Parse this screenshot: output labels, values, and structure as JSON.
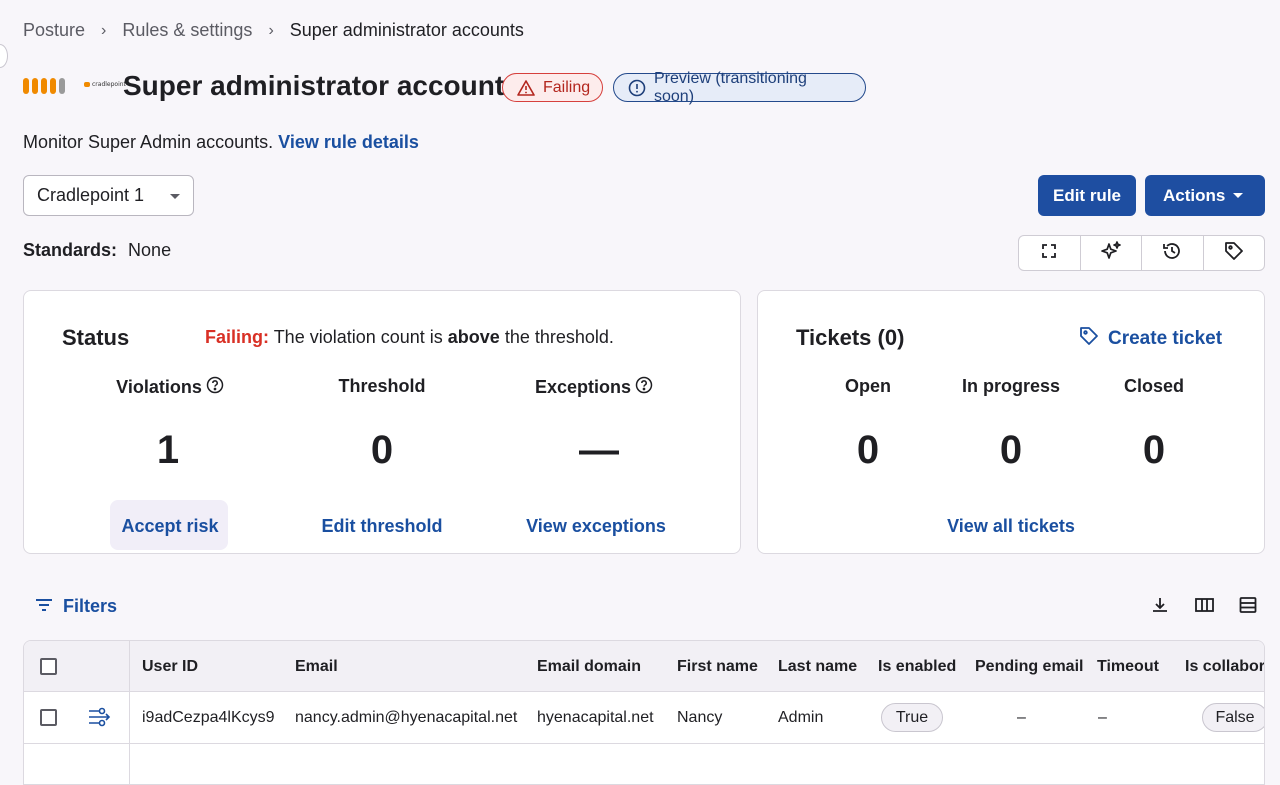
{
  "breadcrumb": {
    "items": [
      "Posture",
      "Rules & settings",
      "Super administrator accounts"
    ],
    "separator": "›"
  },
  "header": {
    "logo_text": "cradlepoint",
    "title": "Super administrator accounts",
    "badge_failing": "Failing",
    "badge_preview": "Preview (transitioning soon)"
  },
  "description": {
    "text": "Monitor Super Admin accounts.",
    "link": "View rule details"
  },
  "tenant_select": {
    "value": "Cradlepoint 1"
  },
  "toolbar": {
    "edit_label": "Edit rule",
    "actions_label": "Actions"
  },
  "standards": {
    "label": "Standards:",
    "value": "None"
  },
  "icon_tools": [
    "expand-icon",
    "sparkle-icon",
    "history-icon",
    "tag-icon"
  ],
  "status_card": {
    "title": "Status",
    "message_prefix": "Failing:",
    "message_1": "The violation count is",
    "message_bold": "above",
    "message_2": "the threshold.",
    "metrics": [
      {
        "label": "Violations",
        "value": "1",
        "action": "Accept risk"
      },
      {
        "label": "Threshold",
        "value": "0",
        "action": "Edit threshold"
      },
      {
        "label": "Exceptions",
        "value": "—",
        "action": "View exceptions"
      }
    ]
  },
  "tickets_card": {
    "title": "Tickets (0)",
    "create_label": "Create ticket",
    "metrics": [
      {
        "label": "Open",
        "value": "0"
      },
      {
        "label": "In progress",
        "value": "0"
      },
      {
        "label": "Closed",
        "value": "0"
      }
    ],
    "view_all": "View all tickets"
  },
  "filters": {
    "label": "Filters"
  },
  "table": {
    "columns": [
      "User ID",
      "Email",
      "Email domain",
      "First name",
      "Last name",
      "Is enabled",
      "Pending email",
      "Timeout",
      "Is collabora"
    ],
    "rows": [
      {
        "user_id": "i9adCezpa4lKcys9",
        "email": "nancy.admin@hyenacapital.net",
        "email_domain": "hyenacapital.net",
        "first_name": "Nancy",
        "last_name": "Admin",
        "is_enabled": "True",
        "pending_email": "–",
        "timeout": "–",
        "is_collaborator": "False"
      }
    ]
  },
  "colors": {
    "primary": "#1e4ea1",
    "link": "#1a4fa0",
    "failing": "#d93025",
    "brand_orange": "#f08a00"
  }
}
